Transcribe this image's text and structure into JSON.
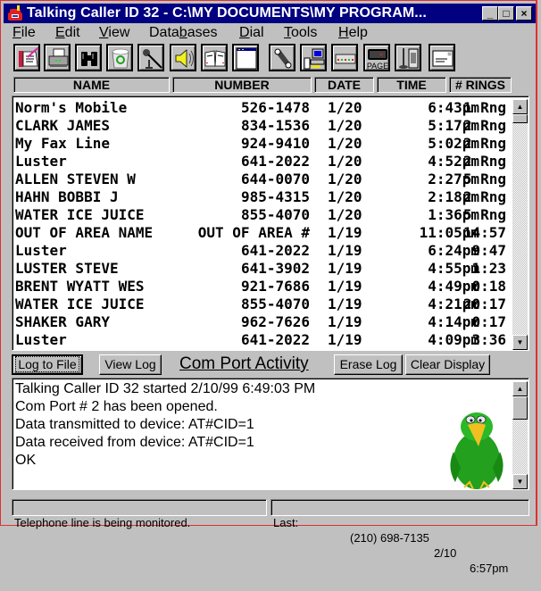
{
  "window": {
    "title": "Talking Caller ID 32 - C:\\MY DOCUMENTS\\MY PROGRAM...",
    "minimize": "_",
    "maximize": "□",
    "close": "×"
  },
  "menu": [
    {
      "label": "File",
      "mnemonic": "F",
      "rest": "ile"
    },
    {
      "label": "Edit",
      "mnemonic": "E",
      "rest": "dit"
    },
    {
      "label": "View",
      "mnemonic": "V",
      "rest": "iew"
    },
    {
      "label": "Databases",
      "pre": "Data",
      "mnemonic": "b",
      "rest": "ases"
    },
    {
      "label": "Dial",
      "mnemonic": "D",
      "rest": "ial"
    },
    {
      "label": "Tools",
      "mnemonic": "T",
      "rest": "ools"
    },
    {
      "label": "Help",
      "mnemonic": "H",
      "rest": "elp"
    }
  ],
  "toolbar": {
    "buttons": [
      {
        "icon": "notebook-edit-icon"
      },
      {
        "icon": "printer-icon"
      },
      {
        "icon": "binoculars-icon"
      },
      {
        "icon": "recycle-bin-icon"
      },
      {
        "icon": "microphone-icon"
      },
      {
        "icon": "speaker-icon"
      },
      {
        "icon": "open-book-icon"
      },
      {
        "icon": "window-icon"
      },
      {
        "icon": "phone-handset-icon"
      },
      {
        "icon": "computer-icon"
      },
      {
        "icon": "modem-icon"
      },
      {
        "icon": "pager-icon",
        "label": "PAGE"
      },
      {
        "icon": "cordless-phone-icon"
      },
      {
        "icon": "envelope-icon"
      }
    ]
  },
  "calls": {
    "columns": [
      "NAME",
      "NUMBER",
      "DATE",
      "TIME",
      "# RINGS"
    ],
    "rows": [
      {
        "name": "Norm's Mobile",
        "number": "526-1478",
        "date": "1/20",
        "time": "6:43pm",
        "rings": "1 Rng"
      },
      {
        "name": "CLARK JAMES",
        "number": "834-1536",
        "date": "1/20",
        "time": "5:17pm",
        "rings": "2 Rng"
      },
      {
        "name": "My Fax Line",
        "number": "924-9410",
        "date": "1/20",
        "time": "5:02pm",
        "rings": "2 Rng"
      },
      {
        "name": "Luster",
        "number": "641-2022",
        "date": "1/20",
        "time": "4:52pm",
        "rings": "2 Rng"
      },
      {
        "name": "ALLEN STEVEN W",
        "number": "644-0070",
        "date": "1/20",
        "time": "2:27pm",
        "rings": "5 Rng"
      },
      {
        "name": "HAHN BOBBI J",
        "number": "985-4315",
        "date": "1/20",
        "time": "2:18pm",
        "rings": "2 Rng"
      },
      {
        "name": "WATER ICE JUICE",
        "number": "855-4070",
        "date": "1/20",
        "time": "1:36pm",
        "rings": "5 Rng"
      },
      {
        "name": "OUT OF AREA NAME",
        "number": "OUT OF AREA #",
        "date": "1/19",
        "time": "11:05pm",
        "rings": "14:57"
      },
      {
        "name": "Luster",
        "number": "641-2022",
        "date": "1/19",
        "time": "6:24pm",
        "rings": "9:47"
      },
      {
        "name": "LUSTER STEVE",
        "number": "641-3902",
        "date": "1/19",
        "time": "4:55pm",
        "rings": "1:23"
      },
      {
        "name": "BRENT WYATT WES",
        "number": "921-7686",
        "date": "1/19",
        "time": "4:49pm",
        "rings": "0:18"
      },
      {
        "name": "WATER ICE JUICE",
        "number": "855-4070",
        "date": "1/19",
        "time": "4:21pm",
        "rings": "20:17"
      },
      {
        "name": "SHAKER GARY",
        "number": "962-7626",
        "date": "1/19",
        "time": "4:14pm",
        "rings": "0:17"
      },
      {
        "name": "Luster",
        "number": "641-2022",
        "date": "1/19",
        "time": "4:09pm",
        "rings": "3:36"
      }
    ]
  },
  "log_controls": {
    "log_to_file": "Log to File",
    "view_log": "View Log",
    "title": "Com Port Activity",
    "erase_log": "Erase Log",
    "clear_display": "Clear Display"
  },
  "log_lines": [
    "Talking Caller ID 32 started 2/10/99 6:49:03 PM",
    "Com Port # 2 has been opened.",
    "Data transmitted to device: AT#CID=1",
    "Data received from device: AT#CID=1",
    "OK"
  ],
  "mascot": {
    "icon": "green-parrot-icon"
  },
  "status": {
    "message": "Telephone line is being monitored.",
    "last_label": "Last:",
    "last_number": "(210) 698-7135",
    "last_date": "2/10",
    "last_time": "6:57pm"
  },
  "colors": {
    "titlebar": "#000080",
    "face": "#c0c0c0",
    "border_accent": "#e03030",
    "parrot_green": "#22a01e",
    "parrot_beak": "#f0c020"
  }
}
